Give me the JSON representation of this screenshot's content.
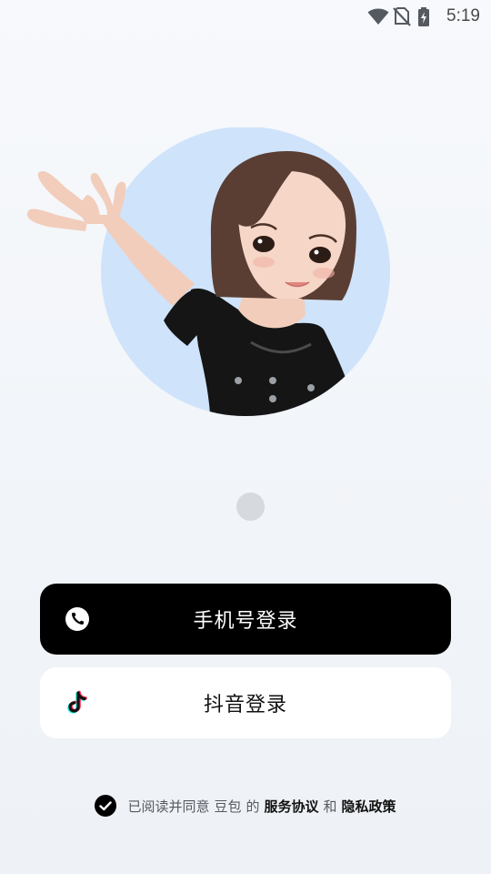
{
  "status_bar": {
    "time": "5:19",
    "icons": [
      "wifi-icon",
      "no-sim-icon",
      "battery-charging-icon"
    ]
  },
  "avatar": {
    "description_icon": "avatar-illustration",
    "bg_color": "#cfe3fb"
  },
  "pager": {
    "active_index": 0,
    "count": 1
  },
  "login": {
    "phone_button_label": "手机号登录",
    "phone_icon": "phone-icon",
    "douyin_button_label": "抖音登录",
    "douyin_icon": "douyin-icon"
  },
  "agreement": {
    "checked": true,
    "prefix": "已阅读并同意",
    "app_name": "豆包",
    "of": "的",
    "service_link": "服务协议",
    "and": "和",
    "privacy_link": "隐私政策"
  },
  "colors": {
    "primary_button": "#000000",
    "secondary_button": "#ffffff",
    "avatar_circle": "#cfe3fb"
  }
}
